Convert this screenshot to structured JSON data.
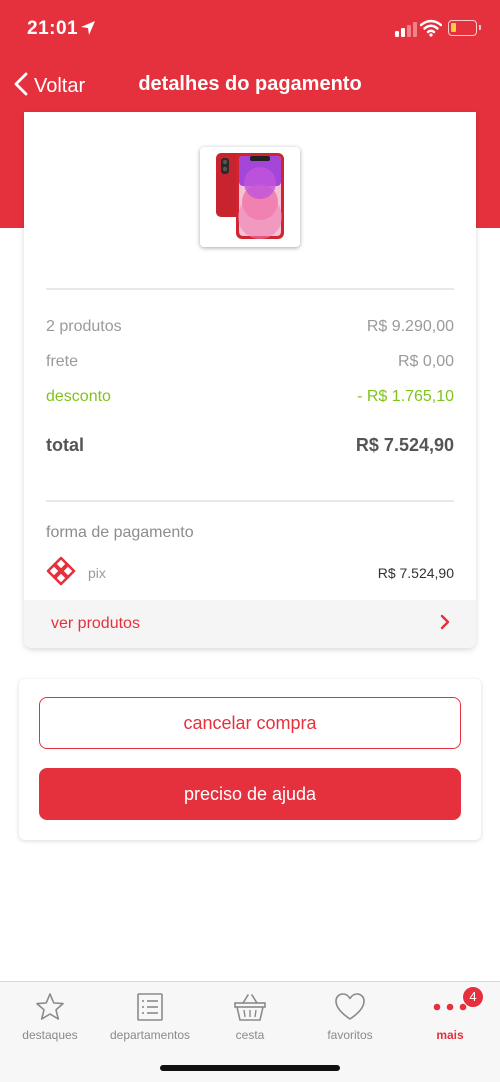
{
  "status_bar": {
    "time": "21:01"
  },
  "nav": {
    "back_label": "Voltar",
    "title": "detalhes do pagamento"
  },
  "summary": {
    "products_label": "2 produtos",
    "products_value": "R$ 9.290,00",
    "shipping_label": "frete",
    "shipping_value": "R$ 0,00",
    "discount_label": "desconto",
    "discount_value": "- R$ 1.765,10",
    "total_label": "total",
    "total_value": "R$ 7.524,90"
  },
  "payment": {
    "label": "forma de pagamento",
    "method": "pix",
    "value": "R$ 7.524,90"
  },
  "see_products_label": "ver produtos",
  "actions": {
    "cancel_label": "cancelar compra",
    "help_label": "preciso de ajuda"
  },
  "tabbar": {
    "items": [
      {
        "label": "destaques",
        "icon": "star-icon"
      },
      {
        "label": "departamentos",
        "icon": "list-icon"
      },
      {
        "label": "cesta",
        "icon": "basket-icon"
      },
      {
        "label": "favoritos",
        "icon": "heart-icon"
      },
      {
        "label": "mais",
        "icon": "more-dots-icon",
        "badge": "4"
      }
    ]
  },
  "colors": {
    "brand_red": "#e5313d",
    "discount_green": "#7fc31c"
  }
}
